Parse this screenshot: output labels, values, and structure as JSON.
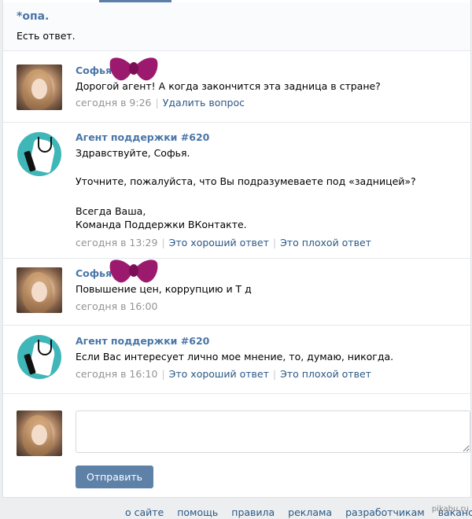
{
  "ticket": {
    "title": "*опа.",
    "text": "Есть ответ."
  },
  "messages": [
    {
      "author": "Софья",
      "avatar": "user-photo",
      "lines": [
        "Дорогой агент! А когда закончится эта задница в стране?"
      ],
      "time": "сегодня в 9:26",
      "actions": [
        "Удалить вопрос"
      ]
    },
    {
      "author": "Агент поддержки #620",
      "avatar": "support-agent-icon",
      "lines": [
        "Здравствуйте, Софья.",
        "",
        "Уточните, пожалуйста, что Вы подразумеваете под «задницей»?",
        "",
        "Всегда Ваша,",
        "Команда Поддержки ВКонтакте."
      ],
      "time": "сегодня в 13:29",
      "actions": [
        "Это хороший ответ",
        "Это плохой ответ"
      ]
    },
    {
      "author": "Софья",
      "avatar": "user-photo",
      "lines": [
        "Повышение цен, коррупцию и Т д"
      ],
      "time": "сегодня в 16:00",
      "actions": []
    },
    {
      "author": "Агент поддержки #620",
      "avatar": "support-agent-icon",
      "lines": [
        "Если Вас интересует лично мое мнение, то, думаю, никогда."
      ],
      "time": "сегодня в 16:10",
      "actions": [
        "Это хороший ответ",
        "Это плохой ответ"
      ]
    }
  ],
  "reply": {
    "button": "Отправить"
  },
  "footer": {
    "links": [
      "о сайте",
      "помощь",
      "правила",
      "реклама",
      "разработчикам",
      "вакансии"
    ]
  },
  "watermark": "pikabu.ru",
  "colors": {
    "link": "#4a76a8",
    "button": "#5e81a8",
    "bow": "#9c1a6e"
  }
}
